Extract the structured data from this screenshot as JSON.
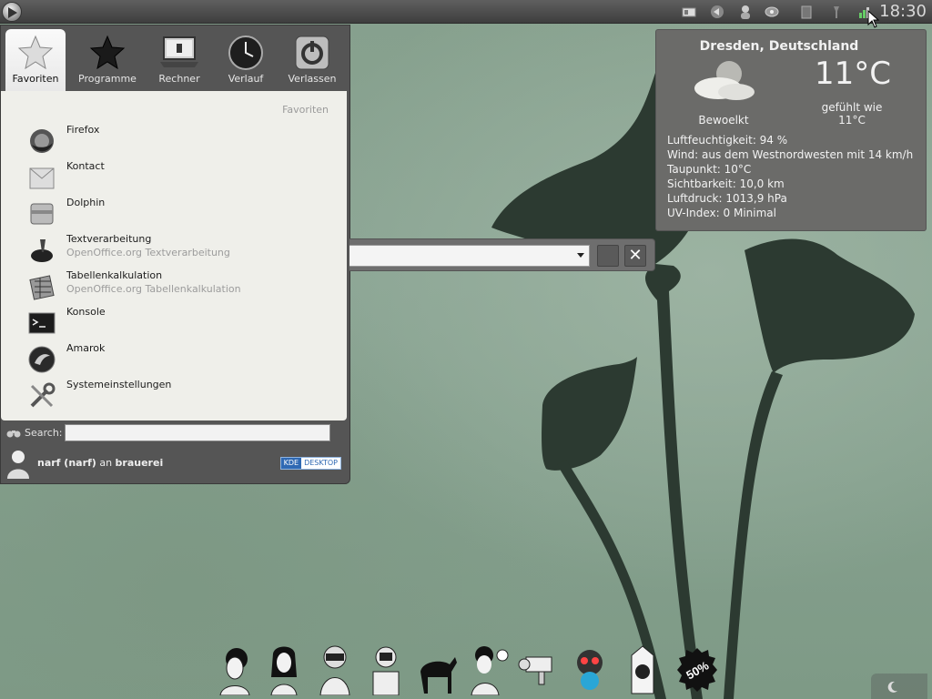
{
  "top_panel": {
    "clock": "18:30",
    "tray_icons": [
      "window-list-icon",
      "media-previous-icon",
      "user-icon",
      "network-icon",
      "notes-icon",
      "flashlight-icon",
      "weather-tray-icon"
    ]
  },
  "kickoff": {
    "tabs": [
      {
        "label": "Favoriten",
        "icon": "star-icon",
        "active": true
      },
      {
        "label": "Programme",
        "icon": "black-star-icon",
        "active": false
      },
      {
        "label": "Rechner",
        "icon": "laptop-icon",
        "active": false
      },
      {
        "label": "Verlauf",
        "icon": "clock-icon",
        "active": false
      },
      {
        "label": "Verlassen",
        "icon": "power-icon",
        "active": false
      }
    ],
    "favorites_heading": "Favoriten",
    "favorites": [
      {
        "title": "Firefox",
        "subtitle": "",
        "icon": "firefox-icon"
      },
      {
        "title": "Kontact",
        "subtitle": "",
        "icon": "kontact-icon"
      },
      {
        "title": "Dolphin",
        "subtitle": "",
        "icon": "dolphin-icon"
      },
      {
        "title": "Textverarbeitung",
        "subtitle": "OpenOffice.org Textverarbeitung",
        "icon": "writer-icon"
      },
      {
        "title": "Tabellenkalkulation",
        "subtitle": "OpenOffice.org Tabellenkalkulation",
        "icon": "calc-icon"
      },
      {
        "title": "Konsole",
        "subtitle": "",
        "icon": "terminal-icon"
      },
      {
        "title": "Amarok",
        "subtitle": "",
        "icon": "amarok-icon"
      },
      {
        "title": "Systemeinstellungen",
        "subtitle": "",
        "icon": "settings-icon"
      }
    ],
    "search": {
      "label": "Search:",
      "placeholder": ""
    },
    "user": {
      "name": "narf (narf)",
      "joiner": "an",
      "host": "brauerei"
    },
    "badge": {
      "kde": "KDE",
      "desktop": "DESKTOP"
    }
  },
  "krunner": {
    "value": "",
    "close_glyph": "✕"
  },
  "weather": {
    "city": "Dresden, Deutschland",
    "temperature": "11°C",
    "condition": "Bewoelkt",
    "feels_label": "gefühlt wie",
    "feels_value": "11°C",
    "details": [
      "Luftfeuchtigkeit: 94 %",
      "Wind: aus dem Westnordwesten mit 14 km/h",
      "Taupunkt: 10°C",
      "Sichtbarkeit: 10,0 km",
      "Luftdruck: 1013,9 hPa",
      "UV-Index: 0 Minimal"
    ]
  },
  "dock": {
    "items": [
      "avatar-woman-1-icon",
      "avatar-woman-2-icon",
      "astronaut-icon",
      "robot-icon",
      "deer-icon",
      "pirate-girl-icon",
      "camera-icon",
      "monkey-icon",
      "milk-carton-icon",
      "sale-badge-icon"
    ],
    "sale_text": "50%"
  },
  "colors": {
    "accent": "#2f69b3",
    "panel": "#4a4a4a",
    "menu_bg": "#efefea"
  }
}
